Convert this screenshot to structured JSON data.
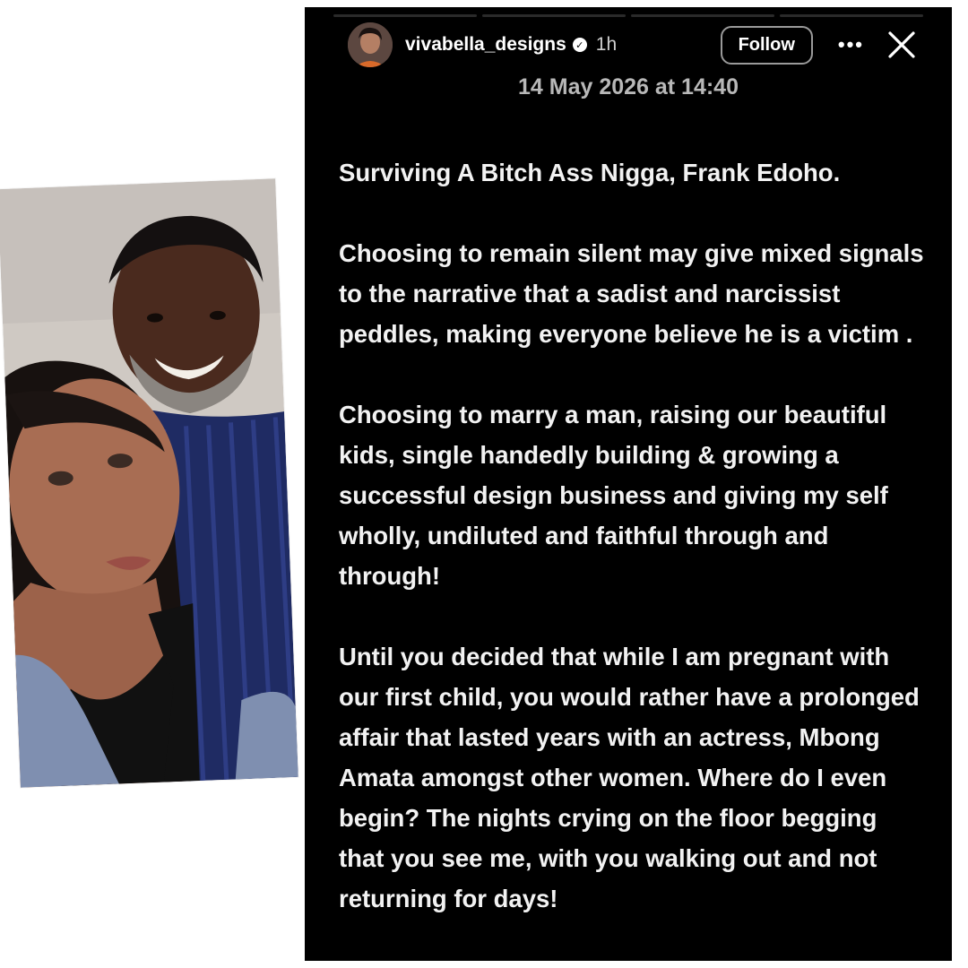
{
  "story": {
    "username": "vivabella_designs",
    "verified_icon": "verified-badge-icon",
    "time_ago": "1h",
    "follow_label": "Follow",
    "more_icon": "more-options-icon",
    "more_glyph": "•••",
    "close_icon": "close-icon",
    "date": "14 May 2026 at 14:40",
    "paragraphs": [
      "Surviving A Bitch Ass Nigga, Frank Edoho.",
      "Choosing to remain silent may give mixed signals to the narrative that a sadist and narcissist peddles, making everyone believe he is a victim .",
      "Choosing to marry a man, raising our beautiful kids, single handedly building & growing a successful design business and giving my self wholly, undiluted and faithful through and through!",
      "Until you decided that while I am pregnant with our first child, you would rather have a prolonged affair that lasted years with an actress, Mbong Amata amongst other women. Where do I even begin? The nights crying on the floor begging that you see me, with you walking out and not returning for days!"
    ]
  },
  "colors": {
    "story_background": "#000000",
    "page_background": "#ffffff",
    "text": "#f2f2f2",
    "date_text": "#b8b8b8"
  }
}
